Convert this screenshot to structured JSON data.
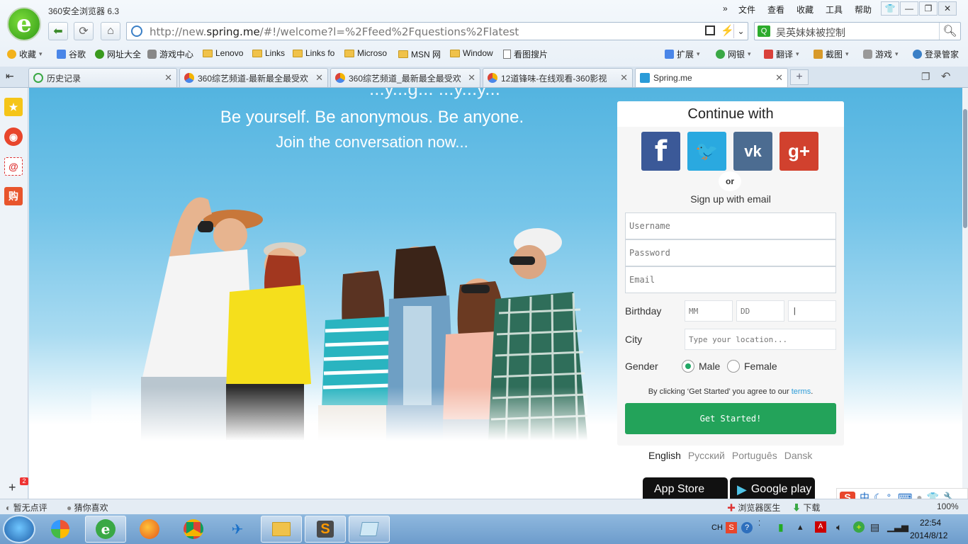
{
  "window": {
    "title": "360安全浏览器 6.3"
  },
  "menu": [
    "文件",
    "查看",
    "收藏",
    "工具",
    "帮助"
  ],
  "menu_more": "»",
  "address": {
    "prefix": "http://new.",
    "domain": "spring.me",
    "suffix": "/#!/welcome?l=%2Ffeed%2Fquestions%2Flatest"
  },
  "search": {
    "value": "吴英妹妹被控制",
    "engine_icon": "search-engine-icon"
  },
  "bookmarks": [
    {
      "label": "收藏",
      "icon": "star"
    },
    {
      "label": "谷歌",
      "icon": "google"
    },
    {
      "label": "网址大全",
      "icon": "globe"
    },
    {
      "label": "游戏中心",
      "icon": "gamepad"
    },
    {
      "label": "Lenovo",
      "icon": "folder"
    },
    {
      "label": "Links",
      "icon": "folder"
    },
    {
      "label": "Links fo",
      "icon": "folder"
    },
    {
      "label": "Microso",
      "icon": "folder"
    },
    {
      "label": "MSN 网",
      "icon": "folder"
    },
    {
      "label": "Window",
      "icon": "folder"
    },
    {
      "label": "看图搜片",
      "icon": "page"
    }
  ],
  "toolbar_right": [
    {
      "label": "扩展"
    },
    {
      "label": "网银"
    },
    {
      "label": "翻译"
    },
    {
      "label": "截图"
    },
    {
      "label": "游戏"
    },
    {
      "label": "登录管家"
    }
  ],
  "tabs": [
    {
      "label": "历史记录",
      "active": false
    },
    {
      "label": "360综艺频道-最新最全最受欢",
      "active": false
    },
    {
      "label": "360综艺频道_最新最全最受欢",
      "active": false
    },
    {
      "label": "12道锋味-在线观看-360影视",
      "active": false
    },
    {
      "label": "Spring.me",
      "active": true
    }
  ],
  "new_tab": "+",
  "page": {
    "hero_cut": "...y...g... ...y...y...",
    "tagline_1": "Be yourself. Be anonymous. Be anyone.",
    "tagline_2": "Join the conversation now...",
    "card_title": "Continue with",
    "social": [
      "Facebook",
      "Twitter",
      "VK",
      "Google+"
    ],
    "social_glyphs": [
      "f",
      "🐦",
      "vk",
      "g+"
    ],
    "or": "or",
    "signup_email": "Sign up with email",
    "username_placeholder": "Username",
    "password_placeholder": "Password",
    "email_placeholder": "Email",
    "birthday_label": "Birthday",
    "mm_placeholder": "MM",
    "dd_placeholder": "DD",
    "yyyy_value": "|",
    "city_label": "City",
    "city_placeholder": "Type your location...",
    "gender_label": "Gender",
    "gender_male": "Male",
    "gender_female": "Female",
    "gender_selected": "Male",
    "terms_prefix": "By clicking ‘Get Started’ you agree to our ",
    "terms_link": "terms",
    "terms_suffix": ".",
    "get_started": "Get Started!",
    "languages": [
      "English",
      "Русский",
      "Português",
      "Dansk"
    ],
    "current_language": "English",
    "app_store": "App Store",
    "google_play": "Google play"
  },
  "statusbar": {
    "left_1": "暂无点评",
    "left_2": "猜你喜欢",
    "right_1": "浏览器医生",
    "right_2": "下载",
    "zoom": "100%"
  },
  "sidebar_badge": "2",
  "taskbar": {
    "time": "22:54",
    "date": "2014/8/12",
    "lang": "CH"
  },
  "ime": {
    "mode": "中"
  },
  "colors": {
    "accent_green": "#23a35a",
    "sky": "#53b4e0",
    "facebook": "#3b5998",
    "twitter": "#2aa9e0",
    "vk": "#4c6c91",
    "gplus": "#d1412e"
  }
}
